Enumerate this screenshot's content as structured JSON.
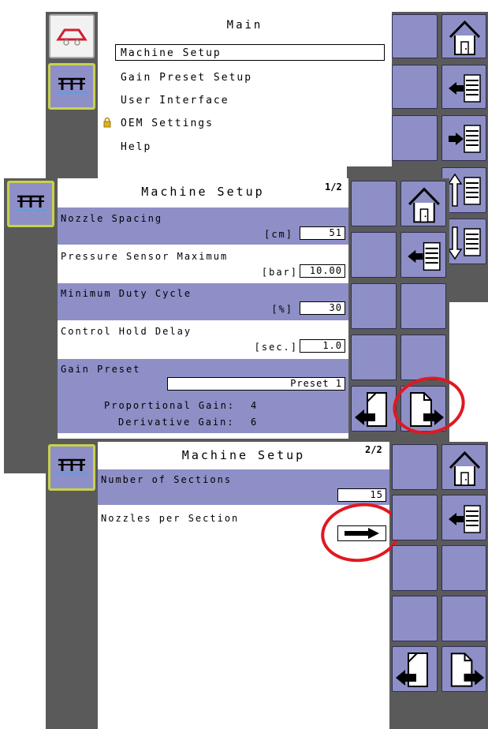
{
  "screen1": {
    "title": "Main",
    "menu": [
      {
        "label": "Machine Setup",
        "selected": true,
        "locked": false
      },
      {
        "label": "Gain Preset Setup",
        "selected": false,
        "locked": false
      },
      {
        "label": "User Interface",
        "selected": false,
        "locked": false
      },
      {
        "label": "OEM Settings",
        "selected": false,
        "locked": true
      },
      {
        "label": "Help",
        "selected": false,
        "locked": false
      }
    ]
  },
  "screen2": {
    "title": "Machine Setup",
    "page": "1/2",
    "fields": [
      {
        "label": "Nozzle Spacing",
        "unit": "[cm]",
        "value": "51"
      },
      {
        "label": "Pressure Sensor Maximum",
        "unit": "[bar]",
        "value": "10.00"
      },
      {
        "label": "Minimum Duty Cycle",
        "unit": "[%]",
        "value": "30"
      },
      {
        "label": "Control Hold Delay",
        "unit": "[sec.]",
        "value": "1.0"
      }
    ],
    "gain_preset": {
      "label": "Gain Preset",
      "value": "Preset 1",
      "proportional_label": "Proportional Gain:",
      "proportional_value": "4",
      "derivative_label": "Derivative Gain:",
      "derivative_value": "6"
    }
  },
  "screen3": {
    "title": "Machine Setup",
    "page": "2/2",
    "sections_label": "Number of Sections",
    "sections_value": "15",
    "nozzles_label": "Nozzles per Section"
  },
  "icons": [
    "boom-icon",
    "nozzle-row-icon",
    "home-icon",
    "back-list-icon",
    "forward-list-icon",
    "scroll-up-icon",
    "scroll-down-icon",
    "page-back-icon",
    "page-forward-icon",
    "arrow-right-icon",
    "lock-icon"
  ],
  "colors": {
    "button": "#8e8fc7",
    "frame": "#5a5a5a",
    "highlight_circle": "#e01820",
    "nozzle_button_border": "#c8d24a"
  }
}
